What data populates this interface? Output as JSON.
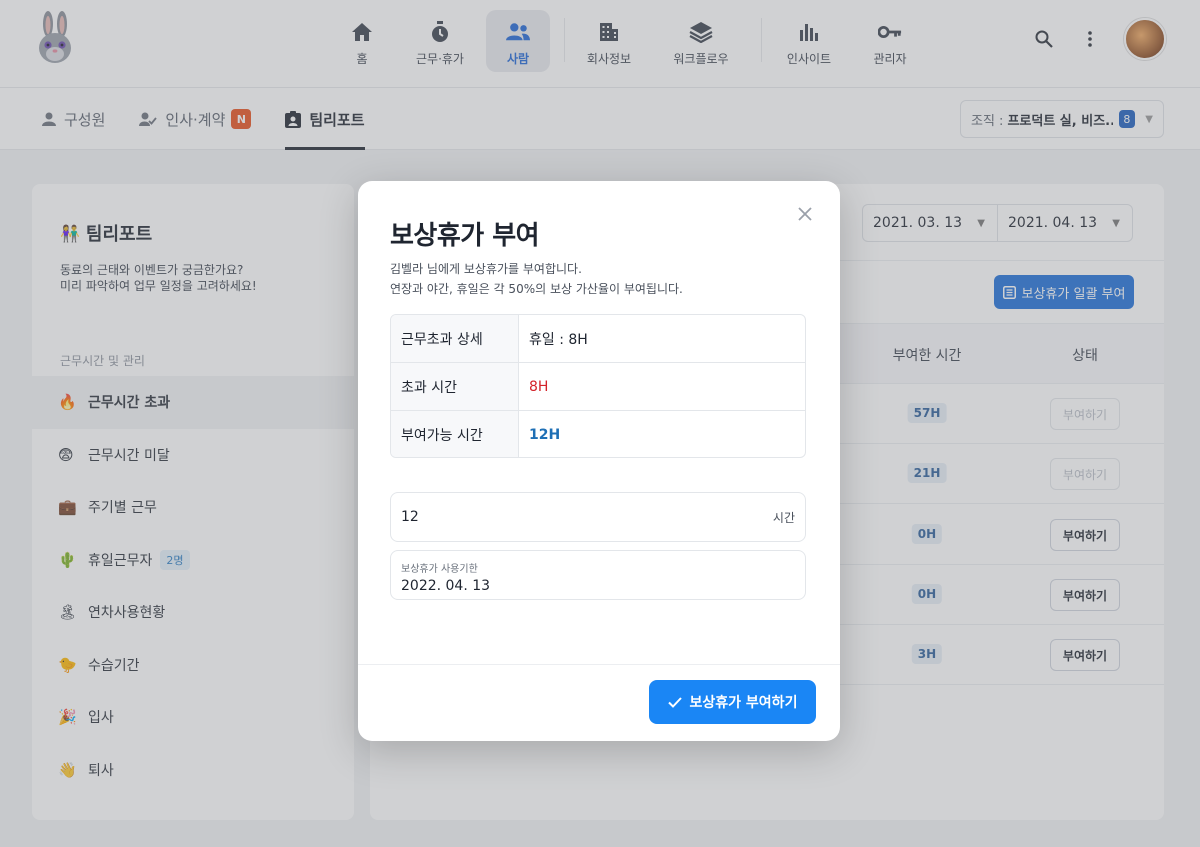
{
  "nav": {
    "items": [
      {
        "label": "홈",
        "icon": "home-icon"
      },
      {
        "label": "근무·휴가",
        "icon": "stopwatch-icon"
      },
      {
        "label": "사람",
        "icon": "people-icon",
        "active": true
      },
      {
        "label": "회사정보",
        "icon": "building-icon"
      },
      {
        "label": "워크플로우",
        "icon": "layers-icon"
      },
      {
        "label": "인사이트",
        "icon": "bar-chart-icon"
      },
      {
        "label": "관리자",
        "icon": "key-icon"
      }
    ]
  },
  "subnav": {
    "tabs": [
      {
        "label": "구성원",
        "icon": "person-icon"
      },
      {
        "label": "인사·계약",
        "icon": "person-check-icon",
        "badge": "N"
      },
      {
        "label": "팀리포트",
        "icon": "badge-icon",
        "active": true
      }
    ],
    "org_label": "조직 :",
    "org_value": "프로덕트 실, 비즈...",
    "org_count": "8"
  },
  "sidebar": {
    "title": "팀리포트",
    "title_emoji": "👫",
    "description": "동료의 근태와 이벤트가 궁금한가요?\n미리 파악하여 업무 일정을 고려하세요!",
    "section": "근무시간 및 관리",
    "items": [
      {
        "emoji": "🔥",
        "label": "근무시간 초과",
        "active": true
      },
      {
        "emoji": "😨",
        "label": "근무시간 미달"
      },
      {
        "emoji": "💼",
        "label": "주기별 근무"
      },
      {
        "emoji": "🌵",
        "label": "휴일근무자",
        "tag": "2명"
      },
      {
        "emoji": "🏝",
        "label": "연차사용현황"
      },
      {
        "emoji": "🐤",
        "label": "수습기간"
      },
      {
        "emoji": "🎉",
        "label": "입사"
      },
      {
        "emoji": "👋",
        "label": "퇴사"
      }
    ]
  },
  "report": {
    "date_from": "2021. 03. 13",
    "date_to": "2021. 04. 13",
    "bulk_button": "보상휴가 일괄 부여",
    "columns": {
      "granted": "부여한 시간",
      "status": "상태"
    },
    "rows": [
      {
        "granted": "57H",
        "action": "부여하기",
        "disabled": true
      },
      {
        "granted": "21H",
        "action": "부여하기",
        "disabled": true
      },
      {
        "granted": "0H",
        "action": "부여하기",
        "disabled": false
      },
      {
        "granted": "0H",
        "action": "부여하기",
        "disabled": false
      },
      {
        "granted": "3H",
        "action": "부여하기",
        "disabled": false
      }
    ]
  },
  "modal": {
    "title": "보상휴가 부여",
    "desc_line1": "김벨라 님에게 보상휴가를 부여합니다.",
    "desc_line2": "연장과 야간, 휴일은 각 50%의 보상 가산율이 부여됩니다.",
    "rows": [
      {
        "key": "근무초과 상세",
        "value": "휴일 : 8H"
      },
      {
        "key": "초과 시간",
        "value": "8H"
      },
      {
        "key": "부여가능 시간",
        "value": "12H"
      }
    ],
    "hours_value": "12",
    "hours_unit": "시간",
    "expiry_label": "보상휴가 사용기한",
    "expiry_value": "2022. 04. 13",
    "submit": "보상휴가 부여하기"
  },
  "colors": {
    "accent": "#1a86f5",
    "primary_dark": "#1e6fd9",
    "danger": "#d3232a",
    "badge_new": "#e8501c"
  }
}
